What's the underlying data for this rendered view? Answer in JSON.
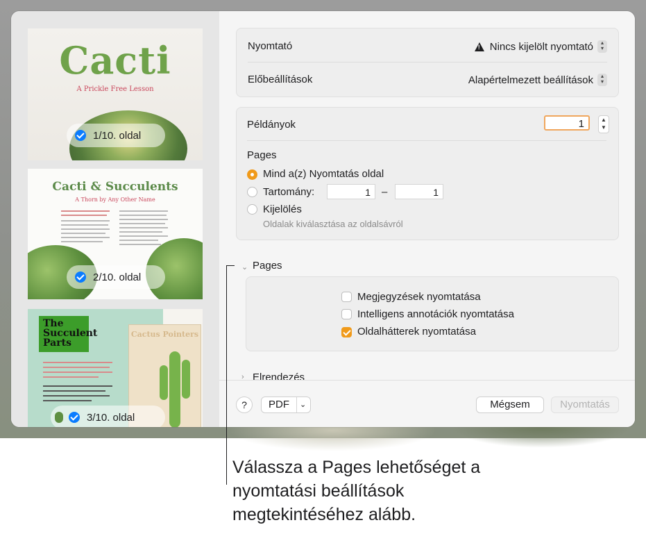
{
  "sidebar": {
    "thumb1": {
      "title": "Cacti",
      "subtitle": "A Prickle Free Lesson",
      "page_label": "1/10. oldal"
    },
    "thumb2": {
      "title": "Cacti & Succulents",
      "subtitle": "A Thorn by Any Other Name",
      "page_label": "2/10. oldal"
    },
    "thumb3": {
      "box_title": "The Succulent Parts",
      "poster_title": "Cactus Pointers",
      "page_label": "3/10. oldal"
    }
  },
  "printer": {
    "label": "Nyomtató",
    "value": "Nincs kijelölt nyomtató"
  },
  "presets": {
    "label": "Előbeállítások",
    "value": "Alapértelmezett beállítások"
  },
  "copies": {
    "label": "Példányok",
    "value": "1"
  },
  "pages": {
    "heading": "Pages",
    "all_label": "Mind a(z) Nyomtatás oldal",
    "range_label": "Tartomány:",
    "range_from": "1",
    "range_dash": "–",
    "range_to": "1",
    "selection_label": "Kijelölés",
    "selection_hint": "Oldalak kiválasztása az oldalsávról"
  },
  "pages_section": {
    "heading": "Pages",
    "options": [
      {
        "label": "Megjegyzések nyomtatása",
        "checked": false
      },
      {
        "label": "Intelligens annotációk nyomtatása",
        "checked": false
      },
      {
        "label": "Oldalhátterek nyomtatása",
        "checked": true
      }
    ]
  },
  "layout_section": {
    "heading": "Elrendezés"
  },
  "footer": {
    "help_label": "?",
    "pdf_label": "PDF",
    "cancel_label": "Mégsem",
    "print_label": "Nyomtatás"
  },
  "callout": {
    "text": "Válassza a Pages lehetőséget a nyomtatási beállítások megtekintéséhez alább."
  },
  "colors": {
    "accent": "#f09a1a",
    "check_blue": "#0a7cff"
  }
}
